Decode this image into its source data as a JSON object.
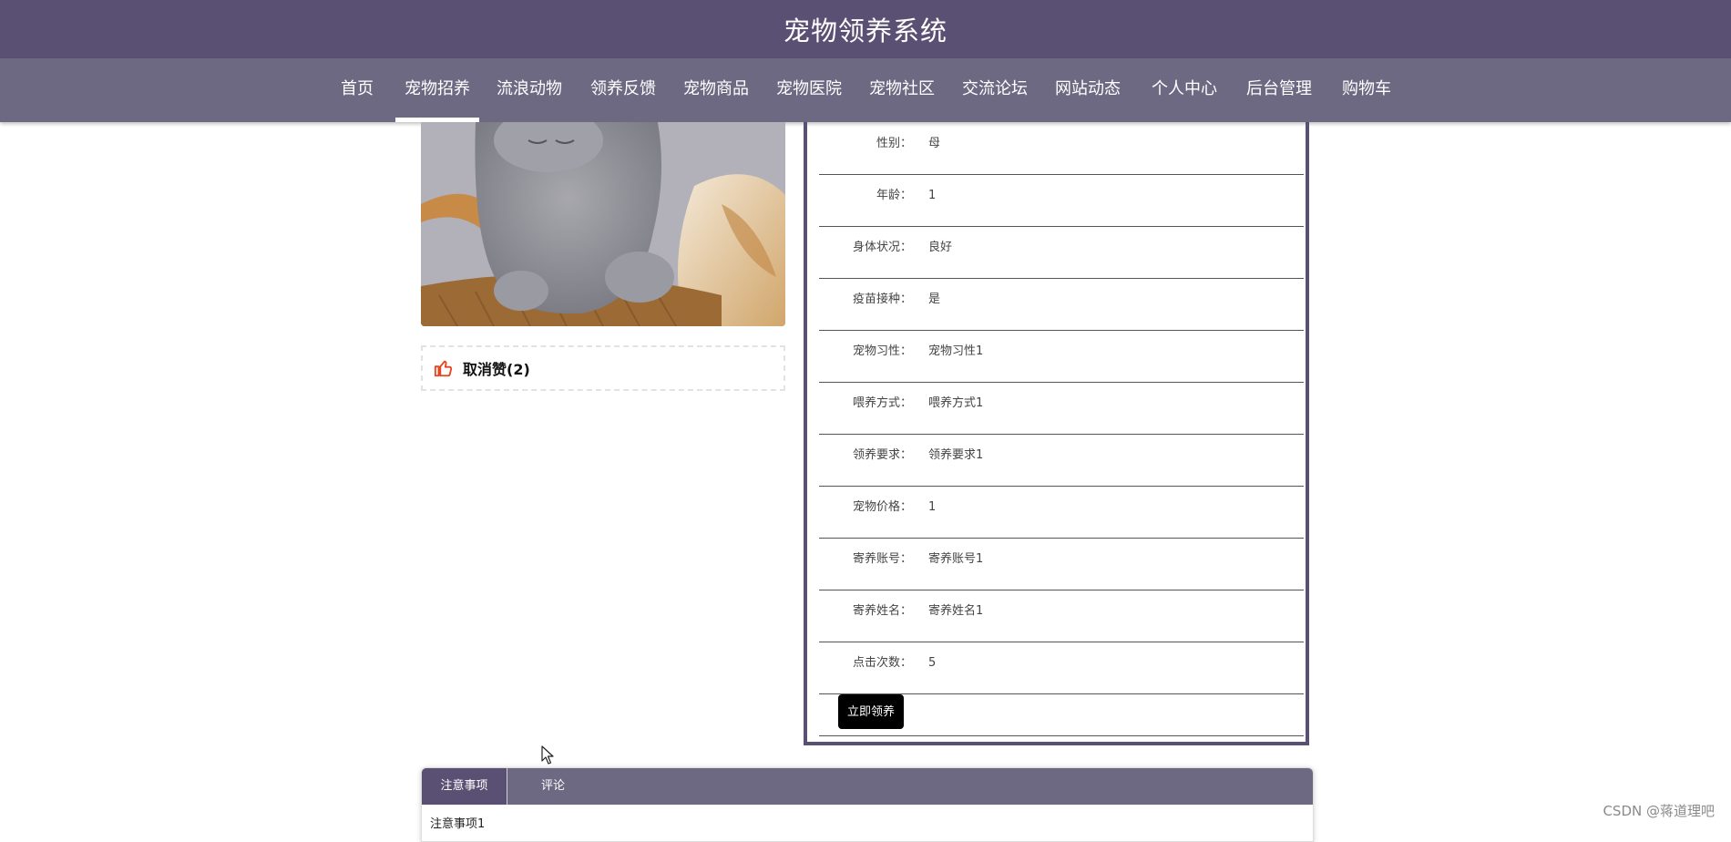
{
  "header": {
    "title": "宠物领养系统"
  },
  "nav": [
    {
      "label": "首页",
      "active": false
    },
    {
      "label": "宠物招养",
      "active": true
    },
    {
      "label": "流浪动物",
      "active": false
    },
    {
      "label": "领养反馈",
      "active": false
    },
    {
      "label": "宠物商品",
      "active": false
    },
    {
      "label": "宠物医院",
      "active": false
    },
    {
      "label": "宠物社区",
      "active": false
    },
    {
      "label": "交流论坛",
      "active": false
    },
    {
      "label": "网站动态",
      "active": false
    },
    {
      "label": "个人中心",
      "active": false
    },
    {
      "label": "后台管理",
      "active": false
    },
    {
      "label": "购物车",
      "active": false
    }
  ],
  "like": {
    "label": "取消赞(2)",
    "icon": "thumbs-up-icon",
    "color": "#e5451f"
  },
  "details": [
    {
      "label": "性别：",
      "value": "母"
    },
    {
      "label": "年龄：",
      "value": "1"
    },
    {
      "label": "身体状况：",
      "value": "良好"
    },
    {
      "label": "疫苗接种：",
      "value": "是"
    },
    {
      "label": "宠物习性：",
      "value": "宠物习性1"
    },
    {
      "label": "喂养方式：",
      "value": "喂养方式1"
    },
    {
      "label": "领养要求：",
      "value": "领养要求1"
    },
    {
      "label": "宠物价格：",
      "value": "1"
    },
    {
      "label": "寄养账号：",
      "value": "寄养账号1"
    },
    {
      "label": "寄养姓名：",
      "value": "寄养姓名1"
    },
    {
      "label": "点击次数：",
      "value": "5"
    }
  ],
  "adopt_button": "立即领养",
  "tabs": [
    {
      "label": "注意事项",
      "active": true
    },
    {
      "label": "评论",
      "active": false
    }
  ],
  "tab_content": "注意事项1",
  "watermark": "CSDN @蒋道理吧",
  "colors": {
    "header": "#5a5073",
    "nav": "#6e6983",
    "accent": "#5a5073"
  }
}
